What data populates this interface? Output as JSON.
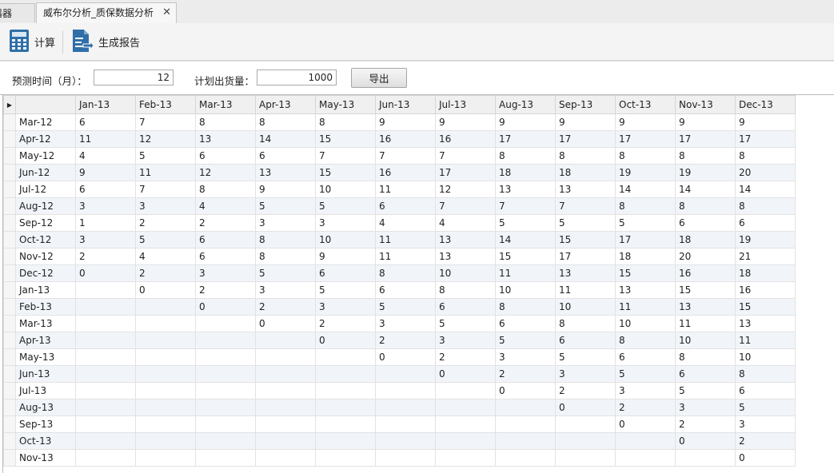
{
  "tabs": [
    {
      "label": "器器",
      "active": false
    },
    {
      "label": "威布尔分析_质保数据分析",
      "active": true
    }
  ],
  "toolbar": {
    "calc_label": "计算",
    "report_label": "生成报告"
  },
  "params": {
    "forecast_label": "预测时间（月）：",
    "forecast_value": "12",
    "shipment_label": "计划出货量：",
    "shipment_value": "1000",
    "export_label": "导出"
  },
  "grid": {
    "columns": [
      "Jan-13",
      "Feb-13",
      "Mar-13",
      "Apr-13",
      "May-13",
      "Jun-13",
      "Jul-13",
      "Aug-13",
      "Sep-13",
      "Oct-13",
      "Nov-13",
      "Dec-13"
    ],
    "rows": [
      {
        "label": "Mar-12",
        "values": [
          "6",
          "7",
          "8",
          "8",
          "8",
          "9",
          "9",
          "9",
          "9",
          "9",
          "9",
          "9"
        ]
      },
      {
        "label": "Apr-12",
        "values": [
          "11",
          "12",
          "13",
          "14",
          "15",
          "16",
          "16",
          "17",
          "17",
          "17",
          "17",
          "17"
        ]
      },
      {
        "label": "May-12",
        "values": [
          "4",
          "5",
          "6",
          "6",
          "7",
          "7",
          "7",
          "8",
          "8",
          "8",
          "8",
          "8"
        ]
      },
      {
        "label": "Jun-12",
        "values": [
          "9",
          "11",
          "12",
          "13",
          "15",
          "16",
          "17",
          "18",
          "18",
          "19",
          "19",
          "20"
        ]
      },
      {
        "label": "Jul-12",
        "values": [
          "6",
          "7",
          "8",
          "9",
          "10",
          "11",
          "12",
          "13",
          "13",
          "14",
          "14",
          "14"
        ]
      },
      {
        "label": "Aug-12",
        "values": [
          "3",
          "3",
          "4",
          "5",
          "5",
          "6",
          "7",
          "7",
          "7",
          "8",
          "8",
          "8"
        ]
      },
      {
        "label": "Sep-12",
        "values": [
          "1",
          "2",
          "2",
          "3",
          "3",
          "4",
          "4",
          "5",
          "5",
          "5",
          "6",
          "6"
        ]
      },
      {
        "label": "Oct-12",
        "values": [
          "3",
          "5",
          "6",
          "8",
          "10",
          "11",
          "13",
          "14",
          "15",
          "17",
          "18",
          "19"
        ]
      },
      {
        "label": "Nov-12",
        "values": [
          "2",
          "4",
          "6",
          "8",
          "9",
          "11",
          "13",
          "15",
          "17",
          "18",
          "20",
          "21"
        ]
      },
      {
        "label": "Dec-12",
        "values": [
          "0",
          "2",
          "3",
          "5",
          "6",
          "8",
          "10",
          "11",
          "13",
          "15",
          "16",
          "18"
        ]
      },
      {
        "label": "Jan-13",
        "values": [
          "",
          "0",
          "2",
          "3",
          "5",
          "6",
          "8",
          "10",
          "11",
          "13",
          "15",
          "16"
        ]
      },
      {
        "label": "Feb-13",
        "values": [
          "",
          "",
          "0",
          "2",
          "3",
          "5",
          "6",
          "8",
          "10",
          "11",
          "13",
          "15"
        ]
      },
      {
        "label": "Mar-13",
        "values": [
          "",
          "",
          "",
          "0",
          "2",
          "3",
          "5",
          "6",
          "8",
          "10",
          "11",
          "13"
        ]
      },
      {
        "label": "Apr-13",
        "values": [
          "",
          "",
          "",
          "",
          "0",
          "2",
          "3",
          "5",
          "6",
          "8",
          "10",
          "11"
        ]
      },
      {
        "label": "May-13",
        "values": [
          "",
          "",
          "",
          "",
          "",
          "0",
          "2",
          "3",
          "5",
          "6",
          "8",
          "10"
        ]
      },
      {
        "label": "Jun-13",
        "values": [
          "",
          "",
          "",
          "",
          "",
          "",
          "0",
          "2",
          "3",
          "5",
          "6",
          "8"
        ]
      },
      {
        "label": "Jul-13",
        "values": [
          "",
          "",
          "",
          "",
          "",
          "",
          "",
          "0",
          "2",
          "3",
          "5",
          "6"
        ]
      },
      {
        "label": "Aug-13",
        "values": [
          "",
          "",
          "",
          "",
          "",
          "",
          "",
          "",
          "0",
          "2",
          "3",
          "5"
        ]
      },
      {
        "label": "Sep-13",
        "values": [
          "",
          "",
          "",
          "",
          "",
          "",
          "",
          "",
          "",
          "0",
          "2",
          "3"
        ]
      },
      {
        "label": "Oct-13",
        "values": [
          "",
          "",
          "",
          "",
          "",
          "",
          "",
          "",
          "",
          "",
          "0",
          "2"
        ]
      },
      {
        "label": "Nov-13",
        "values": [
          "",
          "",
          "",
          "",
          "",
          "",
          "",
          "",
          "",
          "",
          "",
          "0"
        ]
      }
    ]
  },
  "colors": {
    "calc_icon": "#2f6fa8",
    "report_icon": "#2f6fa8",
    "alt_row": "#f1f5fa"
  }
}
